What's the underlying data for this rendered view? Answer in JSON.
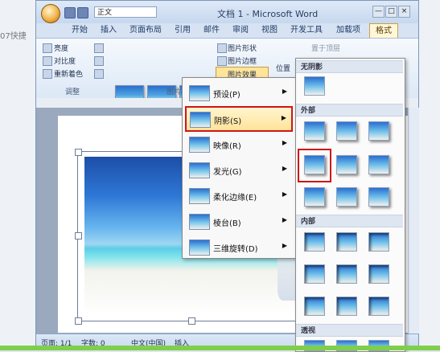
{
  "background": {
    "left_text": "07快捷"
  },
  "window": {
    "title": "文档 1 - Microsoft Word",
    "style_box_value": "正文",
    "controls": [
      "—",
      "□",
      "×"
    ]
  },
  "tabs": [
    "开始",
    "插入",
    "页面布局",
    "引用",
    "邮件",
    "审阅",
    "视图",
    "开发工具",
    "加载项",
    "格式"
  ],
  "ribbon": {
    "adjust": {
      "items": [
        "亮度",
        "对比度",
        "重新着色"
      ],
      "group_label": "调整"
    },
    "picture_styles": {
      "group_label": "图片样式"
    },
    "right_items": [
      "图片形状",
      "图片边框",
      "图片效果"
    ],
    "position_label": "位置",
    "arrange_item": "置于顶层"
  },
  "effects_menu": {
    "items": [
      {
        "label": "预设(P)"
      },
      {
        "label": "阴影(S)"
      },
      {
        "label": "映像(R)"
      },
      {
        "label": "发光(G)"
      },
      {
        "label": "柔化边缘(E)"
      },
      {
        "label": "棱台(B)"
      },
      {
        "label": "三维旋转(D)"
      }
    ]
  },
  "shadow_submenu": {
    "sections": [
      "无阴影",
      "外部",
      "内部",
      "透视"
    ]
  },
  "statusbar": {
    "page": "页面: 1/1",
    "words": "字数: 0",
    "language": "中文(中国)",
    "mode": "插入"
  }
}
